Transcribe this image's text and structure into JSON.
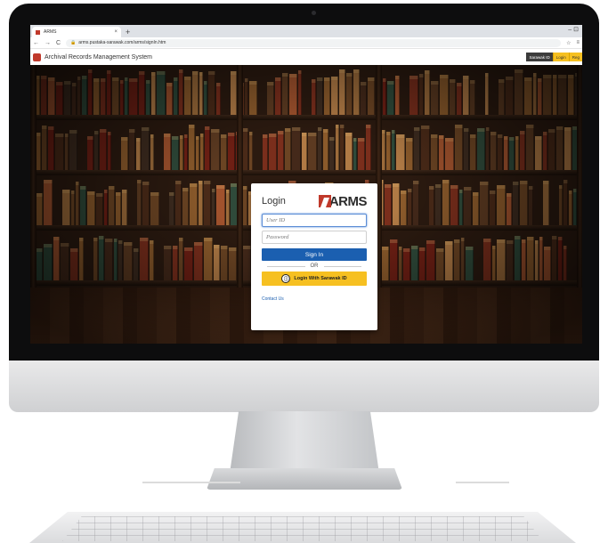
{
  "browser": {
    "tab_title": "ARMS",
    "tab_close": "×",
    "new_tab": "+",
    "window_controls": "–  ⊡",
    "url": "arms.pustaka-sarawak.com/arms/signIn.htm",
    "back": "←",
    "forward": "→",
    "reload": "C",
    "star": "☆",
    "menu": "≡"
  },
  "app": {
    "title": "Archival Records Management System",
    "sarawak_id": "Sarawak ID",
    "login": "Login",
    "register": "Reg"
  },
  "login_card": {
    "heading": "Login",
    "logo_text": "ARMS",
    "user_id_placeholder": "User ID",
    "password_placeholder": "Password",
    "sign_in": "Sign In",
    "or": "OR",
    "sarawak_button": "Login With Sarawak ID",
    "contact": "Contact Us"
  },
  "colors": {
    "brand_red": "#c0392b",
    "signin_blue": "#1b5fb0",
    "sarawak_yellow": "#f6c021"
  }
}
